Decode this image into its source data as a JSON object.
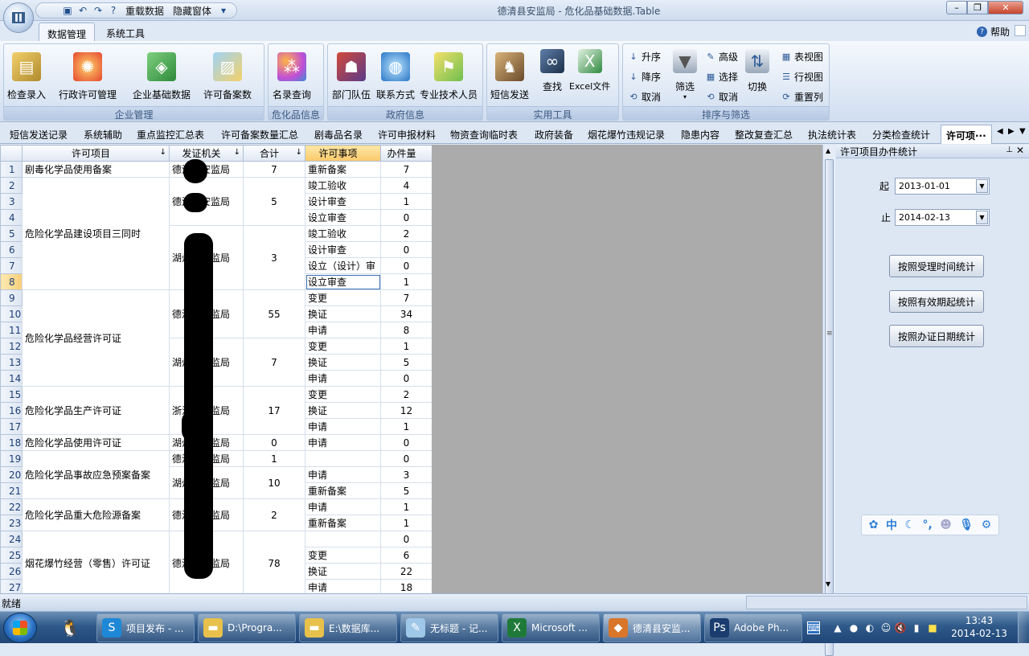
{
  "window": {
    "title": "德清县安监局 - 危化品基础数据.Table"
  },
  "qat": {
    "reload": "重载数据",
    "hide": "隐藏窗体"
  },
  "ribbon_tabs": [
    "数据管理",
    "系统工具"
  ],
  "help": "帮助",
  "groups": [
    {
      "label": "企业管理",
      "buttons": [
        "检查录入",
        "行政许可管理",
        "企业基础数据",
        "许可备案数"
      ]
    },
    {
      "label": "危化品信息",
      "buttons": [
        "名录查询"
      ]
    },
    {
      "label": "政府信息",
      "buttons": [
        "部门队伍",
        "联系方式",
        "专业技术人员"
      ]
    },
    {
      "label": "实用工具",
      "buttons": [
        "短信发送",
        "查找",
        "Excel文件"
      ]
    },
    {
      "label": "排序与筛选",
      "buttons": [
        "升序",
        "降序",
        "取消",
        "筛选",
        "高级",
        "选择",
        "取消",
        "切换",
        "表视图",
        "行视图",
        "重置列"
      ]
    }
  ],
  "doc_tabs": [
    "短信发送记录",
    "系统辅助",
    "重点监控汇总表",
    "许可备案数量汇总",
    "剧毒品名录",
    "许可申报材料",
    "物资查询临时表",
    "政府装备",
    "烟花爆竹违规记录",
    "隐患内容",
    "整改复查汇总",
    "执法统计表",
    "分类检查统计",
    "许可项···"
  ],
  "grid": {
    "columns": [
      "许可项目",
      "发证机关",
      "合计",
      "许可事项",
      "办件量"
    ],
    "row_numbers": [
      "1",
      "2",
      "3",
      "4",
      "5",
      "6",
      "7",
      "8",
      "9",
      "10",
      "11",
      "12",
      "13",
      "14",
      "15",
      "16",
      "17",
      "18",
      "19",
      "20",
      "21",
      "22",
      "23",
      "24",
      "25",
      "26",
      "27"
    ],
    "items": [
      {
        "text": "剧毒化学品使用备案"
      },
      {
        "text": "危险化学品建设项目三同时"
      },
      {
        "text": "危险化学品经营许可证"
      },
      {
        "text": "危险化学品生产许可证"
      },
      {
        "text": "危险化学品使用许可证"
      },
      {
        "text": "危险化学品事故应急预案备案"
      },
      {
        "text": "危险化学品重大危险源备案"
      },
      {
        "text": "烟花爆竹经营（零售）许可证"
      }
    ],
    "issuers": [
      {
        "text": "德清县安监局",
        "total": "7"
      },
      {
        "text": "德清县安监局",
        "total": "5"
      },
      {
        "text": "湖州市安监局",
        "total": "3"
      },
      {
        "text": "德清县安监局",
        "total": "55"
      },
      {
        "text": "湖州市安监局",
        "total": "7"
      },
      {
        "text": "浙江省安监局",
        "total": "17"
      },
      {
        "text": "湖州市安监局",
        "total": "0"
      },
      {
        "text": "德清县安监局",
        "total": "1"
      },
      {
        "text": "湖州市安监局",
        "total": "10"
      },
      {
        "text": "德清县安监局",
        "total": "2"
      },
      {
        "text": "德清县安监局",
        "total": "78"
      }
    ],
    "matters": [
      "重新备案",
      "竣工验收",
      "设计审查",
      "设立审查",
      "竣工验收",
      "设计审查",
      "设立（设计）审",
      "设立审查",
      "变更",
      "换证",
      "申请",
      "变更",
      "换证",
      "申请",
      "变更",
      "换证",
      "申请",
      "申请",
      "",
      "申请",
      "重新备案",
      "申请",
      "重新备案",
      "",
      "变更",
      "换证",
      "申请"
    ],
    "counts": [
      "7",
      "4",
      "1",
      "0",
      "2",
      "0",
      "0",
      "1",
      "7",
      "34",
      "8",
      "1",
      "5",
      "0",
      "2",
      "12",
      "1",
      "0",
      "0",
      "3",
      "5",
      "1",
      "1",
      "0",
      "6",
      "22",
      "18"
    ]
  },
  "side_panel": {
    "title": "许可项目办件统计",
    "from_label": "起",
    "from_value": "2013-01-01",
    "to_label": "止",
    "to_value": "2014-02-13",
    "buttons": [
      "按照受理时间统计",
      "按照有效期起统计",
      "按照办证日期统计"
    ]
  },
  "ime": [
    "中"
  ],
  "status": {
    "text": "就绪"
  },
  "taskbar": {
    "items": [
      "项目发布 - ...",
      "D:\\Progra...",
      "E:\\数据库...",
      "无标题 - 记...",
      "Microsoft ...",
      "德清县安监...",
      "Adobe Ph..."
    ],
    "time": "13:43",
    "date": "2014-02-13"
  },
  "colors": {
    "accent": "#2d64b3",
    "header_highlight": "#f9c96a",
    "grey_area": "#ababab"
  }
}
